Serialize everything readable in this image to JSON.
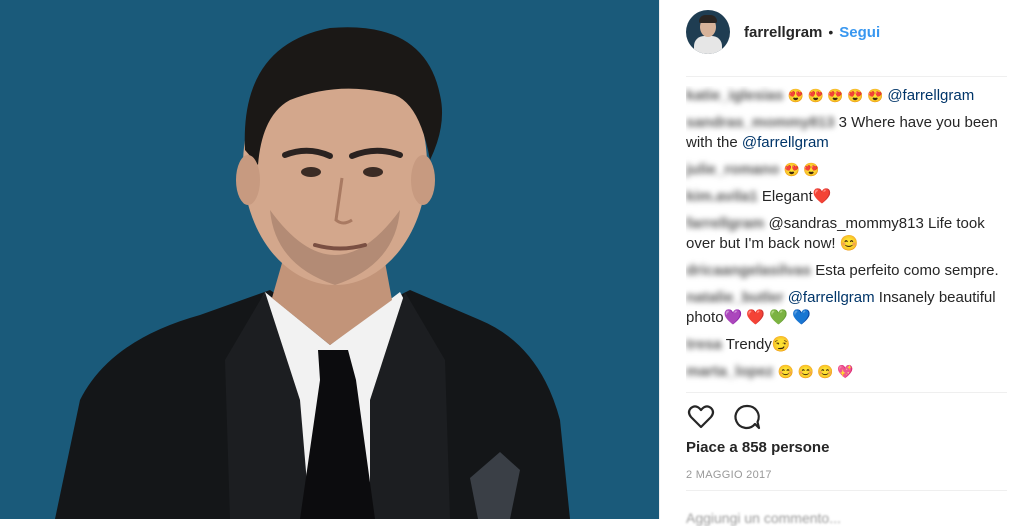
{
  "colors": {
    "photo_bg": "#1a5a7a",
    "link": "#3897f0",
    "mention": "#003569"
  },
  "post": {
    "username": "farrellgram",
    "separator": "•",
    "follow_label": "Segui",
    "likes_text": "Piace a 858 persone",
    "date_text": "2 MAGGIO 2017",
    "add_comment_placeholder": "Aggiungi un commento..."
  },
  "comments": [
    {
      "user": "katie_iglesias",
      "text": "😍 😍 😍 😍 😍",
      "mention": "@farrellgram",
      "after": ""
    },
    {
      "user": "sandras_mommy813",
      "text": "3 Where have you been with the",
      "mention": "@farrellgram",
      "after": ""
    },
    {
      "user": "julie_romano",
      "text": "😍 😍",
      "mention": "",
      "after": ""
    },
    {
      "user": "kim.avila1",
      "text": "Elegant❤️",
      "mention": "",
      "after": ""
    },
    {
      "user": "farrellgram",
      "text": "@sandras_mommy813 Life took over but I'm back now! 😊",
      "mention": "",
      "after": ""
    },
    {
      "user": "dricaangelasilvas",
      "text": "Esta perfeito como sempre.",
      "mention": "",
      "after": ""
    },
    {
      "user": "natalie_butler",
      "text": "",
      "mention": "@farrellgram",
      "after": "Insanely beautiful photo💜 ❤️ 💚 💙"
    },
    {
      "user": "tresa",
      "text": "Trendy😏",
      "mention": "",
      "after": ""
    },
    {
      "user": "marta_lopez",
      "text": "😊 😊 😊 💖",
      "mention": "",
      "after": ""
    }
  ],
  "icons": {
    "like": "heart-outline-icon",
    "comment": "comment-bubble-icon"
  }
}
